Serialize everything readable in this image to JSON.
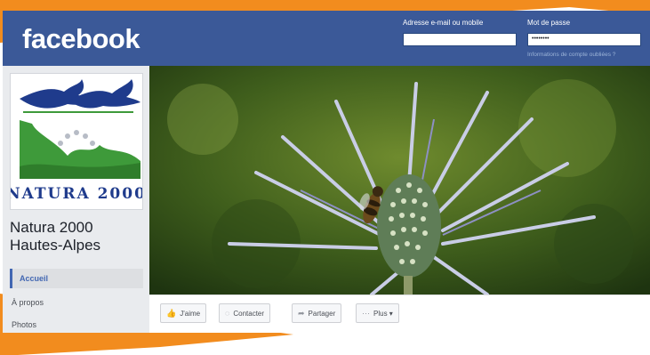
{
  "header": {
    "logo_text": "facebook",
    "email_label": "Adresse e-mail ou mobile",
    "email_value": "",
    "password_label": "Mot de passe",
    "password_value": "••••••••",
    "forgot_link": "Informations de compte oubliées ?"
  },
  "page": {
    "logo_wordmark": "NATURA 2000",
    "name": "Natura 2000 Hautes-Alpes"
  },
  "sidebar": {
    "items": [
      {
        "label": "Accueil",
        "active": true
      },
      {
        "label": "À propos",
        "active": false
      },
      {
        "label": "Photos",
        "active": false
      }
    ]
  },
  "actions": {
    "like": {
      "label": "J'aime",
      "icon": "thumbs-up-icon"
    },
    "contact": {
      "label": "Contacter",
      "icon": "messenger-icon"
    },
    "share": {
      "label": "Partager",
      "icon": "share-arrow-icon"
    },
    "more": {
      "label": "Plus ▾",
      "icon": "more-dots-icon"
    }
  },
  "colors": {
    "facebook_blue": "#3b5998",
    "link_blue": "#4267b2",
    "orange_frame": "#f28c1e",
    "logo_blue": "#1f3b8c",
    "logo_green": "#3e9a3a"
  }
}
